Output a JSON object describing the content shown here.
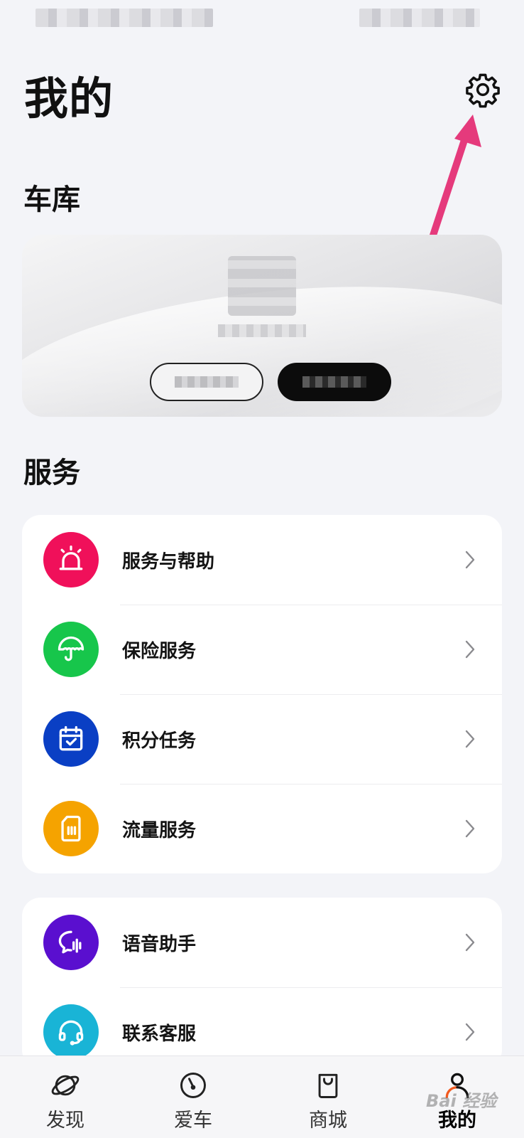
{
  "page": {
    "title": "我的",
    "accent": "#000000",
    "background": "#f3f4f8"
  },
  "header": {
    "settings_icon": "gear-icon"
  },
  "annotation": {
    "arrow_color": "#e53a7c"
  },
  "garage": {
    "section_title": "车库"
  },
  "services": {
    "section_title": "服务",
    "items": [
      {
        "label": "服务与帮助",
        "icon": "siren-icon",
        "color": "#f0105a"
      },
      {
        "label": "保险服务",
        "icon": "umbrella-icon",
        "color": "#17c64b"
      },
      {
        "label": "积分任务",
        "icon": "calendar-check-icon",
        "color": "#0a3fc4"
      },
      {
        "label": "流量服务",
        "icon": "sim-card-icon",
        "color": "#f5a300"
      }
    ]
  },
  "more_services": {
    "items": [
      {
        "label": "语音助手",
        "icon": "voice-chat-icon",
        "color": "#5a0fcf"
      },
      {
        "label": "联系客服",
        "icon": "headset-icon",
        "color": "#19b4d6"
      }
    ]
  },
  "tabbar": {
    "tabs": [
      {
        "label": "发现",
        "icon": "planet-icon"
      },
      {
        "label": "爱车",
        "icon": "speedometer-icon"
      },
      {
        "label": "商城",
        "icon": "shopping-bag-icon"
      },
      {
        "label": "我的",
        "icon": "user-icon",
        "active": true
      }
    ]
  },
  "watermark": {
    "text": "Bai 经验"
  }
}
